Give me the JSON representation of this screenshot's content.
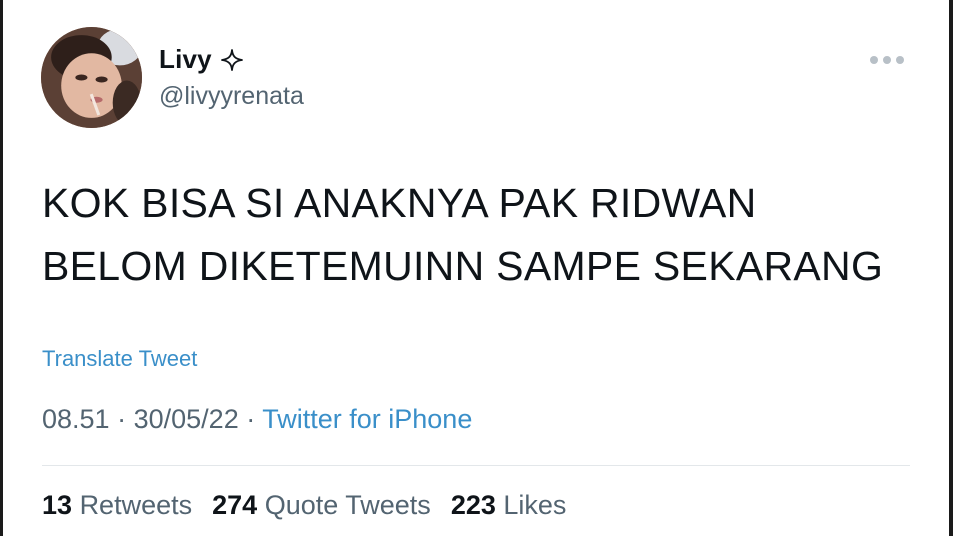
{
  "author": {
    "display_name": "Livy",
    "handle": "@livyyrenata",
    "badge_icon": "sparkle-icon",
    "avatar_icon": "profile-avatar"
  },
  "tweet": {
    "text_line1": "KOK BISA SI ANAKNYA PAK RIDWAN",
    "text_line2": "BELOM DIKETEMUINN SAMPE SEKARANG",
    "translate_label": "Translate Tweet",
    "time": "08.51",
    "date": "30/05/22",
    "separator": "·",
    "source": "Twitter for iPhone"
  },
  "stats": {
    "retweets_count": "13",
    "retweets_label": "Retweets",
    "quotes_count": "274",
    "quotes_label": "Quote Tweets",
    "likes_count": "223",
    "likes_label": "Likes"
  },
  "menu": {
    "icon": "more-icon"
  },
  "colors": {
    "link": "#3a8fc9",
    "secondary_text": "#536471",
    "primary_text": "#0f1419"
  }
}
